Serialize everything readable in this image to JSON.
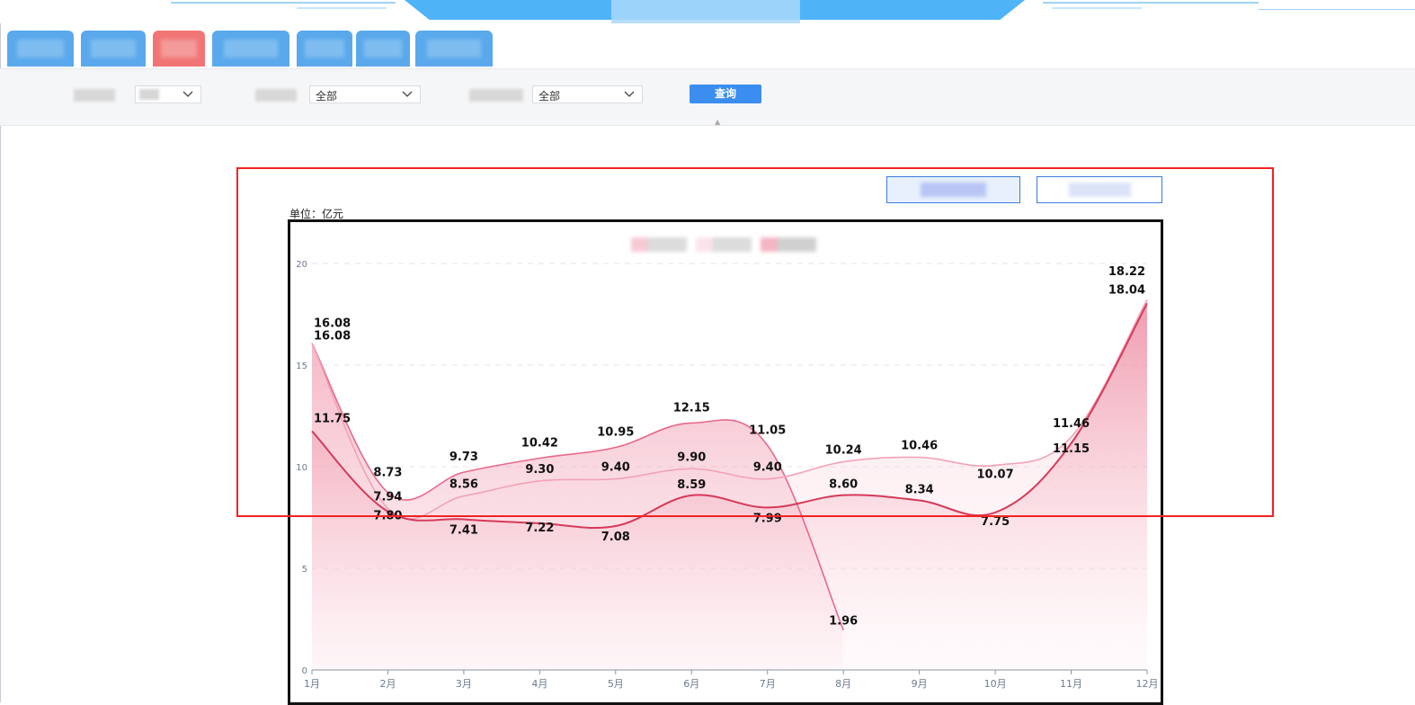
{
  "filters": {
    "select1_value": "",
    "select2_value": "全部",
    "select3_value": "全部",
    "query_label": "查询"
  },
  "chart": {
    "unit_label": "单位：亿元"
  },
  "colors": {
    "series_dark": "#d63a5a",
    "series_mid": "#e8688a",
    "series_light": "#f2a3b8",
    "highlight": "#f32323",
    "query_button": "#3b8ef0"
  },
  "icons": {
    "dropdown": "chevron-down-icon"
  },
  "chart_data": {
    "type": "area",
    "categories": [
      "1月",
      "2月",
      "3月",
      "4月",
      "5月",
      "6月",
      "7月",
      "8月",
      "9月",
      "10月",
      "11月",
      "12月"
    ],
    "ylim": [
      0,
      20
    ],
    "yticks": [
      0,
      5,
      10,
      15,
      20
    ],
    "grid": true,
    "series": [
      {
        "values": [
          16.08,
          8.73,
          9.73,
          10.42,
          10.95,
          12.15,
          11.05,
          1.96,
          null,
          null,
          null,
          null
        ]
      },
      {
        "values": [
          16.08,
          7.94,
          8.56,
          9.3,
          9.4,
          9.9,
          9.4,
          10.24,
          10.46,
          10.07,
          11.46,
          18.22
        ]
      },
      {
        "values": [
          11.75,
          7.8,
          7.41,
          7.22,
          7.08,
          8.59,
          7.99,
          8.6,
          8.34,
          7.75,
          11.15,
          18.04
        ]
      }
    ]
  }
}
